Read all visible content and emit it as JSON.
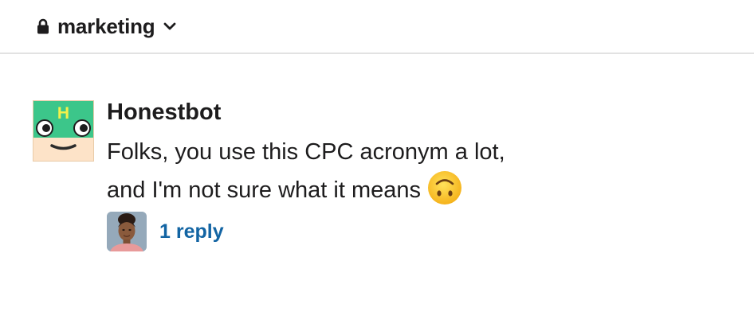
{
  "header": {
    "channel_name": "marketing",
    "lock_icon": "lock-icon",
    "dropdown_icon": "chevron-down-icon"
  },
  "message": {
    "author": "Honestbot",
    "avatar_letter": "H",
    "lines": [
      "Folks, you use this CPC acronym a lot,",
      "and I'm not sure what it means"
    ],
    "emoji": "upside-down-face-icon",
    "thread": {
      "reply_label": "1 reply"
    }
  },
  "colors": {
    "link": "#1264a3",
    "bot_green": "#3cc68a",
    "bot_skin": "#fde3c8",
    "emoji_yellow": "#fbc02d"
  }
}
